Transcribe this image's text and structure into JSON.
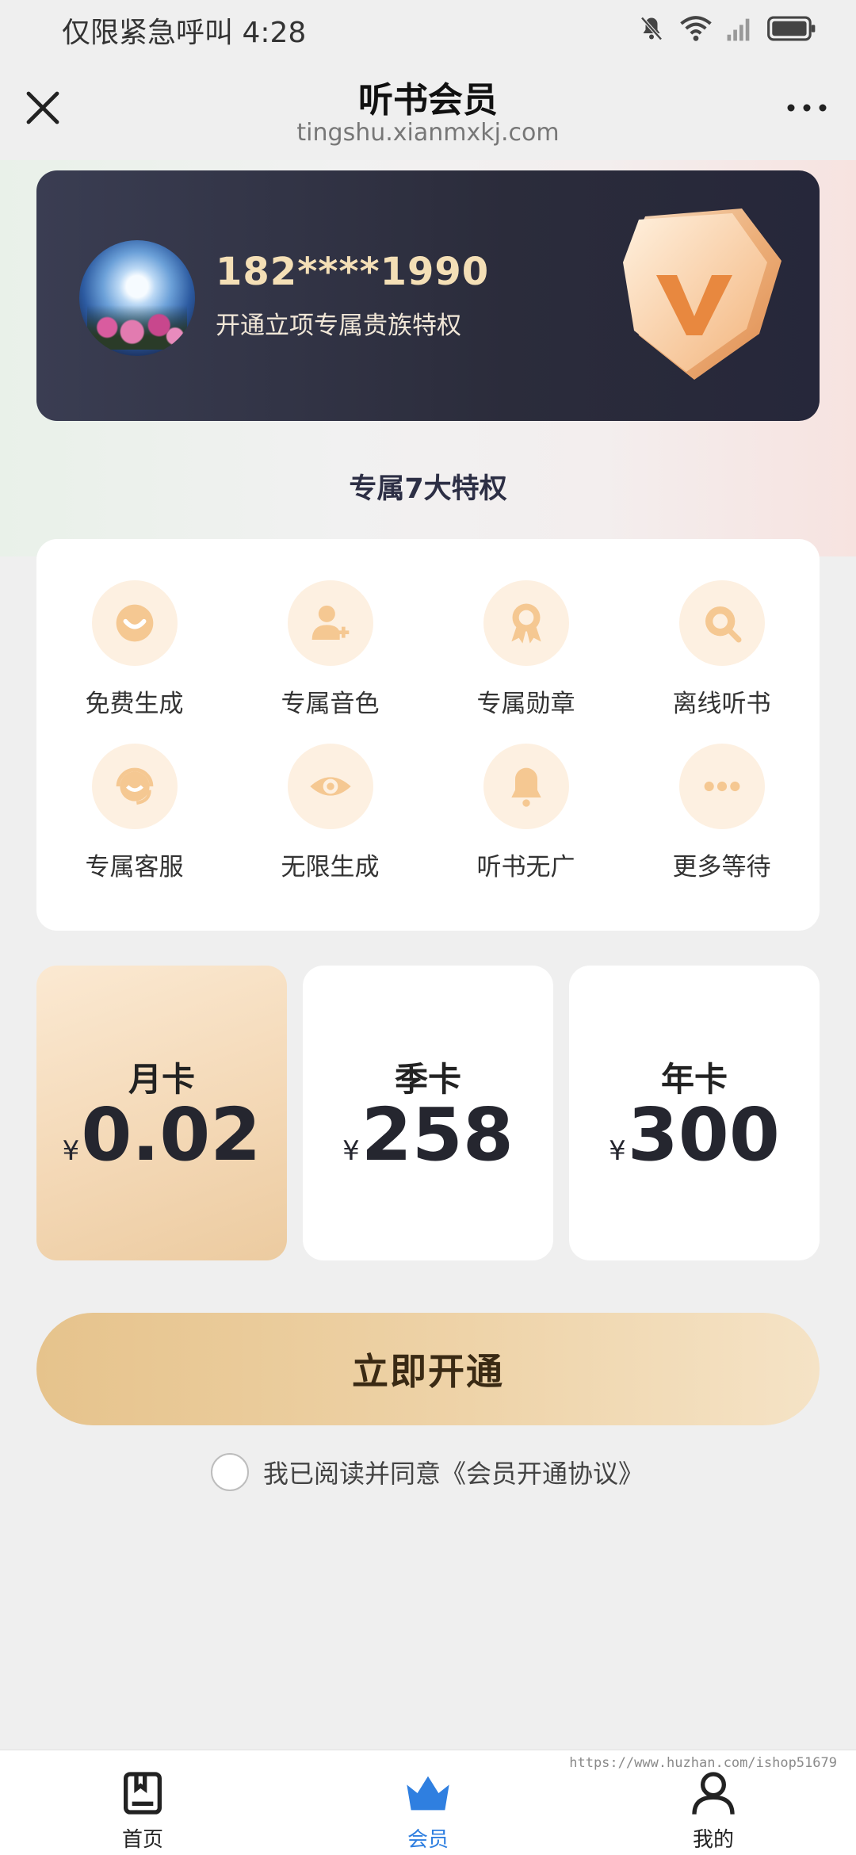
{
  "status_bar": {
    "text": "仅限紧急呼叫 4:28",
    "icons": [
      "bell-off-icon",
      "wifi-icon",
      "signal-icon",
      "battery-icon"
    ]
  },
  "header": {
    "title": "听书会员",
    "url": "tingshu.xianmxkj.com",
    "close_icon": "close-icon",
    "more_icon": "more-icon"
  },
  "member": {
    "phone": "182****1990",
    "subtitle": "开通立项专属贵族特权"
  },
  "privileges": {
    "title": "专属7大特权",
    "items": [
      {
        "label": "免费生成",
        "icon": "smile-icon"
      },
      {
        "label": "专属音色",
        "icon": "add-user-icon"
      },
      {
        "label": "专属勋章",
        "icon": "medal-icon"
      },
      {
        "label": "离线听书",
        "icon": "search-icon"
      },
      {
        "label": "专属客服",
        "icon": "headset-icon"
      },
      {
        "label": "无限生成",
        "icon": "eye-icon"
      },
      {
        "label": "听书无广",
        "icon": "bell-icon"
      },
      {
        "label": "更多等待",
        "icon": "more-dots-icon"
      }
    ]
  },
  "plans": [
    {
      "name": "月卡",
      "currency": "¥",
      "price": "0.02",
      "selected": true
    },
    {
      "name": "季卡",
      "currency": "¥",
      "price": "258",
      "selected": false
    },
    {
      "name": "年卡",
      "currency": "¥",
      "price": "300",
      "selected": false
    }
  ],
  "actions": {
    "open_label": "立即开通",
    "agree_text": "我已阅读并同意《会员开通协议》"
  },
  "bottom_nav": [
    {
      "label": "首页",
      "icon": "book-icon",
      "active": false
    },
    {
      "label": "会员",
      "icon": "crown-icon",
      "active": true
    },
    {
      "label": "我的",
      "icon": "user-icon",
      "active": false
    }
  ],
  "watermark": "https://www.huzhan.com/ishop51679",
  "colors": {
    "accent_gold": "#e6c38c",
    "card_dark": "#2b2c3b",
    "active_blue": "#2f7fe0"
  }
}
